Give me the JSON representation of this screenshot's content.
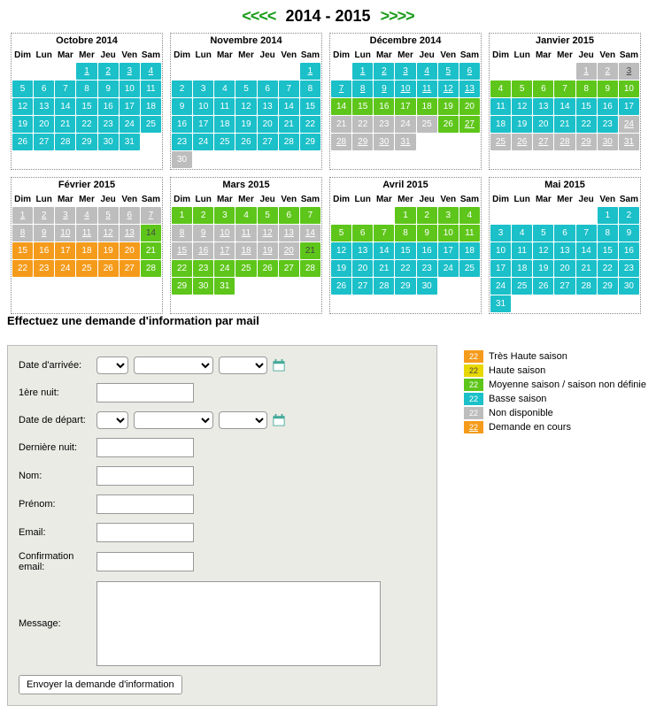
{
  "nav": {
    "prev": "<<<<",
    "next": ">>>>",
    "range": "2014 - 2015"
  },
  "weekdays": [
    "Dim",
    "Lun",
    "Mar",
    "Mer",
    "Jeu",
    "Ven",
    "Sam"
  ],
  "months": [
    {
      "title": "Octobre 2014",
      "start": 3,
      "days": 31,
      "styles": {
        "default": "teal",
        "ul": [
          1,
          2,
          3,
          4
        ]
      }
    },
    {
      "title": "Novembre 2014",
      "start": 6,
      "days": 30,
      "styles": {
        "default": "teal",
        "grey": [
          30
        ],
        "ul": [
          1
        ]
      }
    },
    {
      "title": "Décembre 2014",
      "start": 1,
      "days": 31,
      "styles": {
        "default": "grey",
        "teal": [
          1,
          2,
          3,
          4,
          5,
          6,
          7,
          8,
          9,
          10,
          11,
          12,
          13
        ],
        "green": [
          14,
          15,
          16,
          17,
          18,
          19,
          20,
          26,
          27
        ],
        "ul": [
          1,
          2,
          3,
          4,
          5,
          6,
          7,
          8,
          9,
          10,
          11,
          12,
          13,
          27,
          28,
          29,
          30,
          31
        ]
      }
    },
    {
      "title": "Janvier 2015",
      "start": 4,
      "days": 31,
      "styles": {
        "default": "grey",
        "green": [
          4,
          5,
          6,
          7,
          8,
          9,
          10
        ],
        "teal": [
          11,
          12,
          13,
          14,
          15,
          16,
          17,
          18,
          19,
          20,
          21,
          22,
          23
        ],
        "ul": [
          1,
          2,
          3,
          24,
          25,
          26,
          27,
          28,
          29,
          30,
          31
        ],
        "dark": [
          3
        ]
      }
    },
    {
      "title": "Février 2015",
      "start": 0,
      "days": 28,
      "styles": {
        "default": "orange",
        "grey": [
          1,
          2,
          3,
          4,
          5,
          6,
          7,
          8,
          9,
          10,
          11,
          12,
          13
        ],
        "green": [
          14,
          21,
          28
        ],
        "ul": [
          1,
          2,
          3,
          4,
          5,
          6,
          7,
          8,
          9,
          10,
          11,
          12,
          13
        ],
        "dark": [
          14
        ]
      }
    },
    {
      "title": "Mars 2015",
      "start": 0,
      "days": 31,
      "styles": {
        "default": "green",
        "grey": [
          8,
          9,
          10,
          11,
          12,
          13,
          14,
          15,
          16,
          17,
          18,
          19,
          20
        ],
        "ul": [
          8,
          9,
          10,
          11,
          12,
          13,
          14,
          15,
          16,
          17,
          18,
          19,
          20
        ],
        "dark": [
          21
        ]
      }
    },
    {
      "title": "Avril 2015",
      "start": 3,
      "days": 30,
      "styles": {
        "default": "teal",
        "green": [
          1,
          2,
          3,
          4,
          5,
          6,
          7,
          8,
          9,
          10,
          11
        ]
      }
    },
    {
      "title": "Mai 2015",
      "start": 5,
      "days": 31,
      "styles": {
        "default": "teal"
      }
    }
  ],
  "form": {
    "title": "Effectuez une demande d'information par mail",
    "labels": {
      "arrive": "Date d'arrivée:",
      "first_night": "1ère nuit:",
      "depart": "Date de départ:",
      "last_night": "Dernière nuit:",
      "nom": "Nom:",
      "prenom": "Prénom:",
      "email": "Email:",
      "confirm": "Confirmation email:",
      "message": "Message:"
    },
    "submit": "Envoyer la demande d'information"
  },
  "legend": [
    {
      "box": "22",
      "cls": "orange",
      "label": "Très Haute saison"
    },
    {
      "box": "22",
      "cls": "yellow dark",
      "label": "Haute saison"
    },
    {
      "box": "22",
      "cls": "green",
      "label": "Moyenne saison / saison non définie"
    },
    {
      "box": "22",
      "cls": "teal",
      "label": "Basse saison"
    },
    {
      "box": "22",
      "cls": "grey",
      "label": "Non disponible"
    },
    {
      "box": "22",
      "cls": "orange ul",
      "label": "Demande en cours"
    }
  ]
}
